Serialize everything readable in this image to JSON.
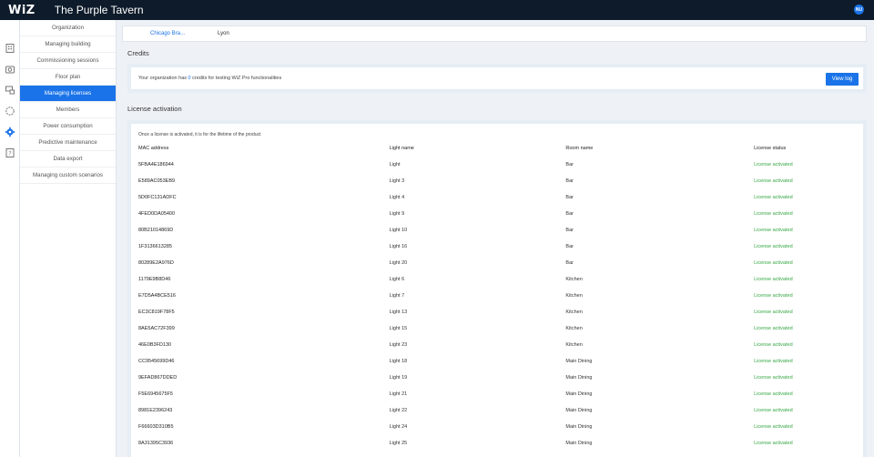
{
  "topbar": {
    "logo": "WiZ",
    "title": "The Purple Tavern",
    "avatar": "NU"
  },
  "rail": {
    "icons": [
      "building-icon",
      "camera-icon",
      "devices-icon",
      "circle-icon",
      "gear-icon",
      "help-icon"
    ]
  },
  "subnav": {
    "items": [
      {
        "label": "Organization"
      },
      {
        "label": "Managing building"
      },
      {
        "label": "Commissioning sessions"
      },
      {
        "label": "Floor plan"
      },
      {
        "label": "Managing licenses",
        "active": true
      },
      {
        "label": "Members"
      },
      {
        "label": "Power consumption"
      },
      {
        "label": "Predictive maintenance"
      },
      {
        "label": "Data export"
      },
      {
        "label": "Managing custom scenarios"
      }
    ]
  },
  "site_tabs": {
    "active": "Chicago Bra...",
    "other": "Lyon"
  },
  "credits": {
    "title": "Credits",
    "text_before": "Your organization has ",
    "count": "0",
    "text_after": " credits for testing WiZ Pro functionalities",
    "view_log_label": "View log"
  },
  "license": {
    "title": "License activation",
    "note": "Once a license is activated, it is for the lifetime of the product",
    "columns": [
      "MAC address",
      "Light name",
      "Room name",
      "License status"
    ],
    "rows": [
      [
        "5FBA4E186944",
        "Light",
        "Bar",
        "License activated"
      ],
      [
        "E589AC053EB9",
        "Light 3",
        "Bar",
        "License activated"
      ],
      [
        "5D0FC131ADFC",
        "Light 4",
        "Bar",
        "License activated"
      ],
      [
        "4FED0DA05400",
        "Light 9",
        "Bar",
        "License activated"
      ],
      [
        "80B21014869D",
        "Light 10",
        "Bar",
        "License activated"
      ],
      [
        "1F3136613285",
        "Light 16",
        "Bar",
        "License activated"
      ],
      [
        "80289E2A976D",
        "Light 20",
        "Bar",
        "License activated"
      ],
      [
        "1179E9B8D46",
        "Light 6",
        "Kitchen",
        "License activated"
      ],
      [
        "E7D5A4BCE516",
        "Light 7",
        "Kitchen",
        "License activated"
      ],
      [
        "EC3C819F78F5",
        "Light 13",
        "Kitchen",
        "License activated"
      ],
      [
        "8AE5AC72F399",
        "Light 15",
        "Kitchen",
        "License activated"
      ],
      [
        "46E0B3FD130",
        "Light 23",
        "Kitchen",
        "License activated"
      ],
      [
        "CC9545699D46",
        "Light 18",
        "Main Dining",
        "License activated"
      ],
      [
        "9EFAD867DDED",
        "Light 19",
        "Main Dining",
        "License activated"
      ],
      [
        "F5E6945675F5",
        "Light 21",
        "Main Dining",
        "License activated"
      ],
      [
        "8981E2396243",
        "Light 22",
        "Main Dining",
        "License activated"
      ],
      [
        "F66603D310B5",
        "Light 24",
        "Main Dining",
        "License activated"
      ],
      [
        "8A31395C3936",
        "Light 25",
        "Main Dining",
        "License activated"
      ]
    ]
  },
  "colors": {
    "accent": "#1a73e8",
    "topbar": "#0d1b2a",
    "activated": "#35a843"
  }
}
